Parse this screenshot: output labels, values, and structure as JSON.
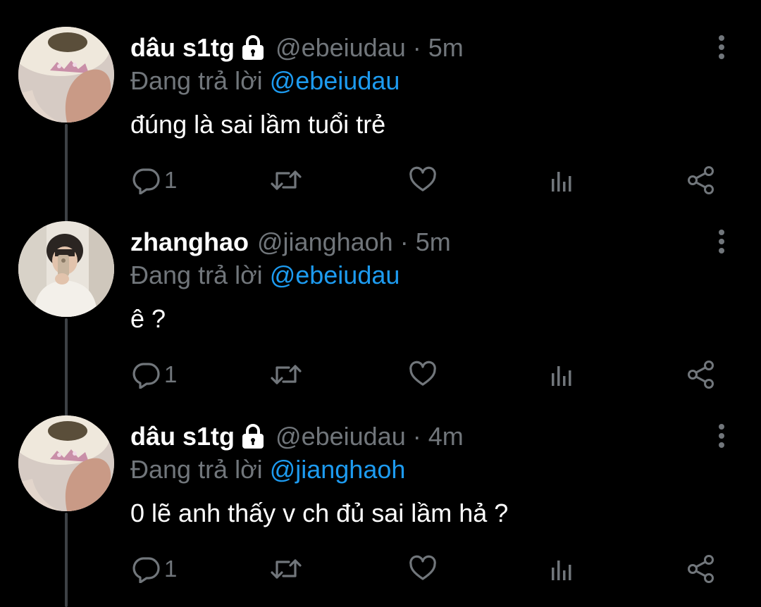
{
  "colors": {
    "background": "#000000",
    "primary_text": "#ffffff",
    "secondary_text": "#71767b",
    "mention": "#1d9bf0",
    "thread_line": "#3d4145"
  },
  "tweets": [
    {
      "display_name": "dâu s1tg",
      "protected": true,
      "lock_icon": "lock-icon",
      "handle": "@ebeiudau",
      "separator": "·",
      "time": "5m",
      "replying_prefix": "Đang trả lời",
      "replying_to": "@ebeiudau",
      "text": "đúng là sai lầm tuổi trẻ",
      "reply_count": "1"
    },
    {
      "display_name": "zhanghao",
      "protected": false,
      "handle": "@jianghaoh",
      "separator": "·",
      "time": "5m",
      "replying_prefix": "Đang trả lời",
      "replying_to": "@ebeiudau",
      "text": "ê ?",
      "reply_count": "1"
    },
    {
      "display_name": "dâu s1tg",
      "protected": true,
      "lock_icon": "lock-icon",
      "handle": "@ebeiudau",
      "separator": "·",
      "time": "4m",
      "replying_prefix": "Đang trả lời",
      "replying_to": "@jianghaoh",
      "text": "0 lẽ anh thấy v ch đủ sai lầm hả ?",
      "reply_count": "1"
    }
  ],
  "action_icons": [
    "reply-icon",
    "retweet-icon",
    "like-icon",
    "analytics-icon",
    "share-icon"
  ],
  "menu_icon": "more-options-icon"
}
